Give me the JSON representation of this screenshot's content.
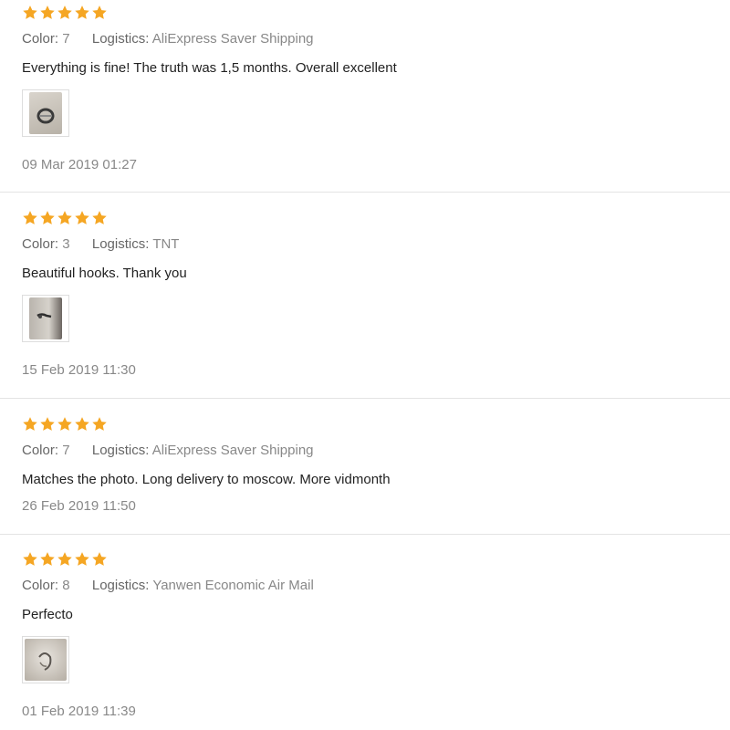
{
  "labels": {
    "color": "Color:",
    "logistics": "Logistics:"
  },
  "star_color": "#f5a623",
  "reviews": [
    {
      "rating": 5,
      "color_value": "7",
      "logistics_value": "AliExpress Saver Shipping",
      "text": "Everything is fine! The truth was 1,5 months. Overall excellent",
      "date": "09 Mar 2019 01:27"
    },
    {
      "rating": 5,
      "color_value": "3",
      "logistics_value": "TNT",
      "text": "Beautiful hooks. Thank you",
      "date": "15 Feb 2019 11:30"
    },
    {
      "rating": 5,
      "color_value": "7",
      "logistics_value": "AliExpress Saver Shipping",
      "text": "Matches the photo. Long delivery to moscow. More vidmonth",
      "date": "26 Feb 2019 11:50"
    },
    {
      "rating": 5,
      "color_value": "8",
      "logistics_value": "Yanwen Economic Air Mail",
      "text": "Perfecto",
      "date": "01 Feb 2019 11:39"
    }
  ]
}
